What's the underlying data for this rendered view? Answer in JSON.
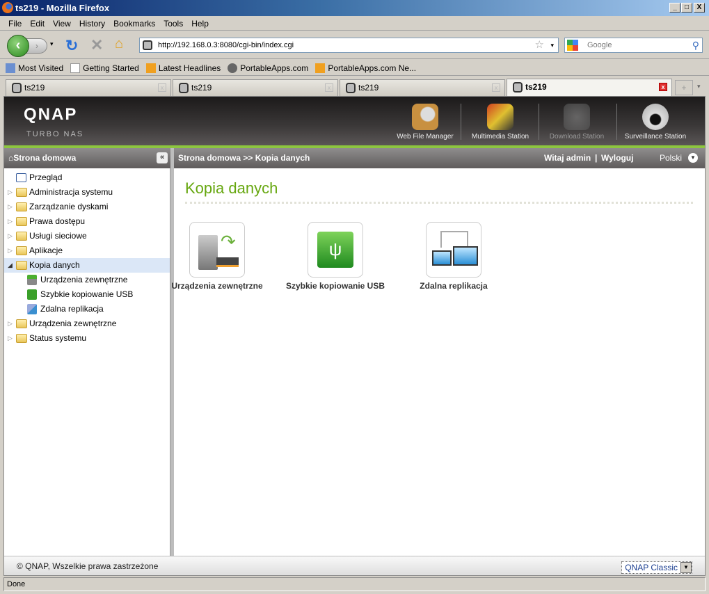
{
  "window": {
    "title": "ts219 - Mozilla Firefox"
  },
  "menu": [
    "File",
    "Edit",
    "View",
    "History",
    "Bookmarks",
    "Tools",
    "Help"
  ],
  "nav": {
    "url": "http://192.168.0.3:8080/cgi-bin/index.cgi",
    "search_placeholder": "Google"
  },
  "bookmarks": [
    {
      "label": "Most Visited",
      "icon": "most-visited-icon"
    },
    {
      "label": "Getting Started",
      "icon": "page-icon"
    },
    {
      "label": "Latest Headlines",
      "icon": "rss-icon"
    },
    {
      "label": "PortableApps.com",
      "icon": "portableapps-icon"
    },
    {
      "label": "PortableApps.com Ne...",
      "icon": "rss-icon"
    }
  ],
  "tabs": [
    {
      "label": "ts219"
    },
    {
      "label": "ts219"
    },
    {
      "label": "ts219"
    },
    {
      "label": "ts219",
      "active": true
    }
  ],
  "header": {
    "logo": "QNAP",
    "subtitle": "Turbo NAS",
    "stations": [
      {
        "label": "Web File Manager"
      },
      {
        "label": "Multimedia Station"
      },
      {
        "label": "Download Station",
        "disabled": true
      },
      {
        "label": "Surveillance Station"
      }
    ]
  },
  "sidebar": {
    "title": "Strona domowa",
    "items": [
      {
        "label": "Przegląd"
      },
      {
        "label": "Administracja systemu"
      },
      {
        "label": "Zarządzanie dyskami"
      },
      {
        "label": "Prawa dostępu"
      },
      {
        "label": "Usługi sieciowe"
      },
      {
        "label": "Aplikacje"
      },
      {
        "label": "Kopia danych",
        "expanded": true,
        "selected": true
      },
      {
        "label": "Urządzenia zewnętrzne",
        "child": true
      },
      {
        "label": "Szybkie kopiowanie USB",
        "child": true
      },
      {
        "label": "Zdalna replikacja",
        "child": true
      },
      {
        "label": "Urządzenia zewnętrzne"
      },
      {
        "label": "Status systemu"
      }
    ]
  },
  "topbar": {
    "breadcrumb": "Strona domowa >> Kopia danych",
    "welcome": "Witaj admin",
    "sep": "|",
    "logout": "Wyloguj",
    "language": "Polski"
  },
  "main": {
    "title": "Kopia danych",
    "items": [
      {
        "label": "Urządzenia zewnętrzne"
      },
      {
        "label": "Szybkie kopiowanie USB"
      },
      {
        "label": "Zdalna replikacja"
      }
    ]
  },
  "footer": {
    "copyright": "© QNAP, Wszelkie prawa zastrzeżone",
    "theme": "QNAP Classic"
  },
  "status": "Done",
  "colors": {
    "accent": "#66a70f",
    "greenline": "#8dc63f"
  }
}
